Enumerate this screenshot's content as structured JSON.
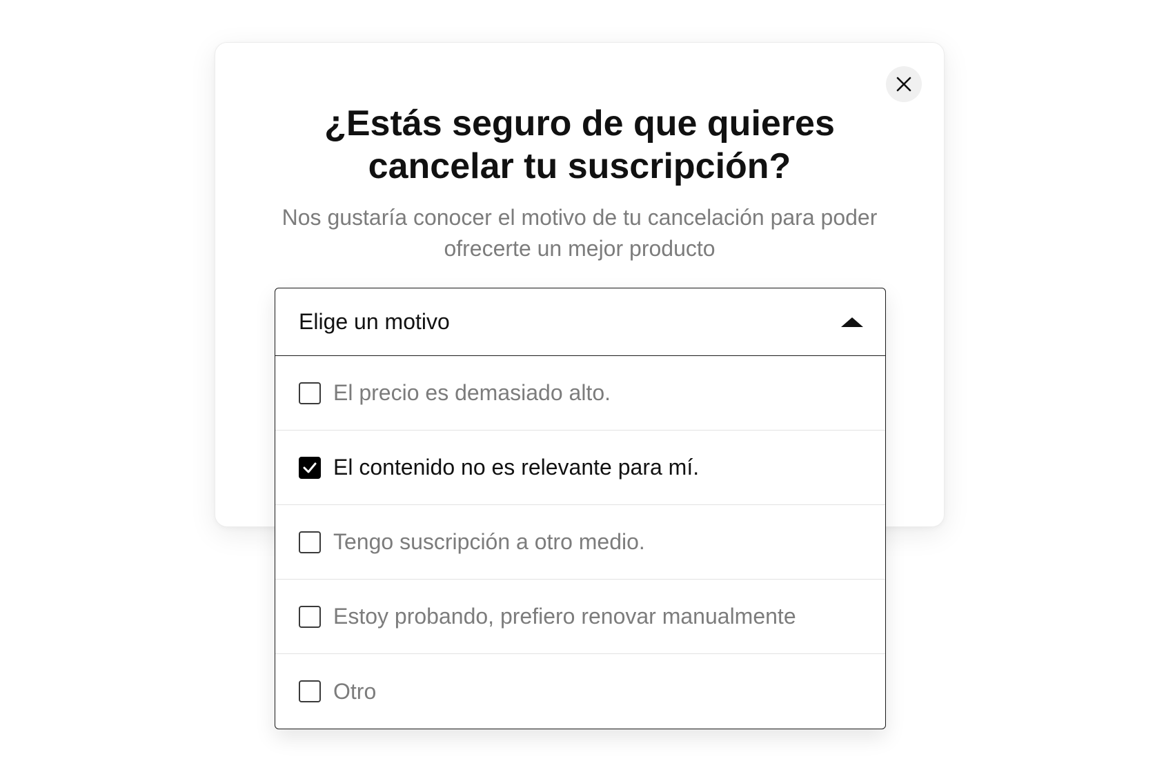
{
  "modal": {
    "title_line1": "¿Estás seguro de que quieres",
    "title_line2": "cancelar tu suscripción?",
    "subtitle_line1": "Nos gustaría conocer el motivo de tu cancelación para poder",
    "subtitle_line2": "ofrecerte un mejor producto",
    "close_icon": "close-icon"
  },
  "dropdown": {
    "label": "Elige un motivo",
    "state": "expanded",
    "caret_icon": "caret-up-icon",
    "options": [
      {
        "label": "El precio es demasiado alto.",
        "checked": false
      },
      {
        "label": "El contenido no es relevante para mí.",
        "checked": true
      },
      {
        "label": "Tengo suscripción a otro medio.",
        "checked": false
      },
      {
        "label": "Estoy probando, prefiero renovar manualmente",
        "checked": false
      },
      {
        "label": "Otro",
        "checked": false
      }
    ]
  },
  "colors": {
    "text_primary": "#111111",
    "text_muted": "#7c7c7c",
    "checkbox_checked": "#000000",
    "close_button_bg": "#f0f0f0"
  }
}
